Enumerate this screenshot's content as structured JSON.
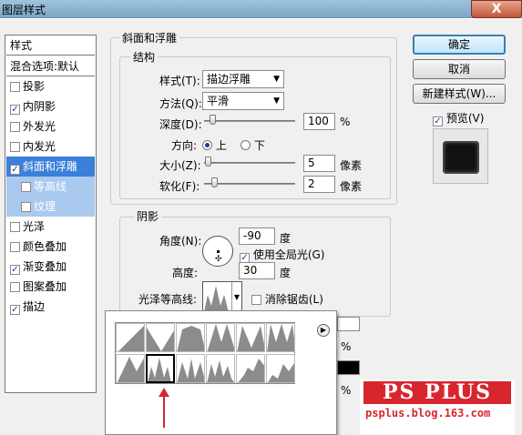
{
  "window": {
    "title": "图层样式",
    "close_glyph": "X"
  },
  "style_list": {
    "header": "样式",
    "blend": "混合选项:默认",
    "items": [
      {
        "label": "投影",
        "checked": false
      },
      {
        "label": "内阴影",
        "checked": true
      },
      {
        "label": "外发光",
        "checked": false
      },
      {
        "label": "内发光",
        "checked": false
      },
      {
        "label": "斜面和浮雕",
        "checked": true,
        "selected": true
      },
      {
        "label": "等高线",
        "checked": false,
        "sub": true
      },
      {
        "label": "纹理",
        "checked": false,
        "sub": true
      },
      {
        "label": "光泽",
        "checked": false
      },
      {
        "label": "颜色叠加",
        "checked": false
      },
      {
        "label": "渐变叠加",
        "checked": true
      },
      {
        "label": "图案叠加",
        "checked": false
      },
      {
        "label": "描边",
        "checked": true
      }
    ]
  },
  "bevel": {
    "group_title": "斜面和浮雕",
    "structure_title": "结构",
    "style_label": "样式(T):",
    "style_value": "描边浮雕",
    "technique_label": "方法(Q):",
    "technique_value": "平滑",
    "depth_label": "深度(D):",
    "depth_value": "100",
    "depth_unit": "%",
    "direction_label": "方向:",
    "dir_up": "上",
    "dir_down": "下",
    "size_label": "大小(Z):",
    "size_value": "5",
    "size_unit": "像素",
    "soften_label": "软化(F):",
    "soften_value": "2",
    "soften_unit": "像素"
  },
  "shading": {
    "title": "阴影",
    "angle_label": "角度(N):",
    "angle_value": "-90",
    "angle_unit": "度",
    "global_light": "使用全局光(G)",
    "altitude_label": "高度:",
    "altitude_value": "30",
    "altitude_unit": "度",
    "gloss_label": "光泽等高线:",
    "antialias": "消除锯齿(L)",
    "pct1": "%",
    "pct2": "%"
  },
  "buttons": {
    "ok": "确定",
    "cancel": "取消",
    "new_style": "新建样式(W)...",
    "preview": "预览(V)"
  },
  "watermark": {
    "brand": "PS PLUS",
    "url": "psplus.blog.163.com"
  },
  "colors": {
    "accent": "#3a7fd8",
    "brand_red": "#d8262e"
  }
}
